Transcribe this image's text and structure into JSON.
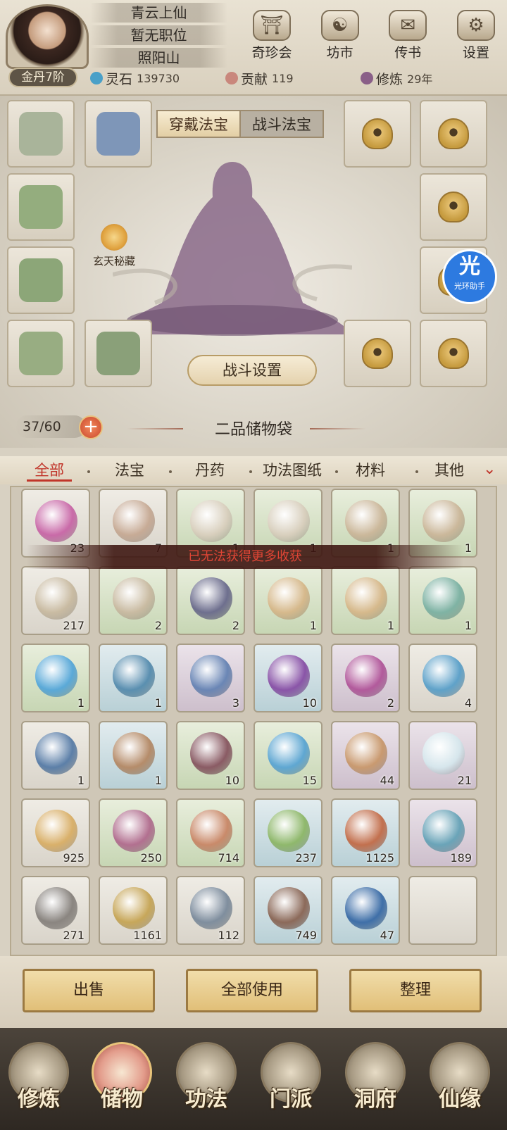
{
  "header": {
    "titles": [
      "青云上仙",
      "暂无职位",
      "照阳山"
    ],
    "realm": "金丹7阶",
    "icons": [
      {
        "label": "奇珍会",
        "icon": "treasure-pavilion-icon"
      },
      {
        "label": "坊市",
        "icon": "market-icon"
      },
      {
        "label": "传书",
        "icon": "scroll-letter-icon"
      },
      {
        "label": "设置",
        "icon": "gear-icon"
      }
    ],
    "resources": [
      {
        "label": "灵石",
        "value": "139730",
        "color": "#4aa0c8"
      },
      {
        "label": "贡献",
        "value": "119",
        "color": "#c9877c"
      },
      {
        "label": "修炼",
        "value": "29年",
        "color": "#8a5f88"
      }
    ]
  },
  "equip": {
    "tab_wear": "穿戴法宝",
    "tab_battle": "战斗法宝",
    "event_label": "玄天秘藏",
    "battle_setting": "战斗设置",
    "helper_big": "光",
    "helper_small": "光环助手",
    "capacity": "37/60",
    "bag_title": "二品储物袋"
  },
  "categories": [
    "全部",
    "法宝",
    "丹药",
    "功法图纸",
    "材料",
    "其他"
  ],
  "toast": "已无法获得更多收获",
  "items": [
    {
      "q": "23",
      "bg": "w",
      "color": "#c96aa8"
    },
    {
      "q": "7",
      "bg": "w",
      "color": "#c7ab96"
    },
    {
      "q": "1",
      "bg": "g",
      "color": "#d8cfbd"
    },
    {
      "q": "1",
      "bg": "g",
      "color": "#d8cfbd"
    },
    {
      "q": "1",
      "bg": "g",
      "color": "#cbb89b"
    },
    {
      "q": "1",
      "bg": "g",
      "color": "#cbb89b"
    },
    {
      "q": "217",
      "bg": "w",
      "color": "#c9bba2"
    },
    {
      "q": "2",
      "bg": "g",
      "color": "#c9bba2"
    },
    {
      "q": "2",
      "bg": "g",
      "color": "#6e6f8e"
    },
    {
      "q": "1",
      "bg": "g",
      "color": "#d6b98c"
    },
    {
      "q": "1",
      "bg": "g",
      "color": "#d6b98c"
    },
    {
      "q": "1",
      "bg": "g",
      "color": "#7fb3a4"
    },
    {
      "q": "1",
      "bg": "g",
      "color": "#5aa9d8"
    },
    {
      "q": "1",
      "bg": "b",
      "color": "#5a8fb0"
    },
    {
      "q": "3",
      "bg": "p",
      "color": "#6a86b5"
    },
    {
      "q": "10",
      "bg": "b",
      "color": "#8a55a8"
    },
    {
      "q": "2",
      "bg": "p",
      "color": "#b25a9c"
    },
    {
      "q": "4",
      "bg": "w",
      "color": "#5fa2c9"
    },
    {
      "q": "1",
      "bg": "w",
      "color": "#5c7fa8"
    },
    {
      "q": "1",
      "bg": "b",
      "color": "#b58c6a"
    },
    {
      "q": "10",
      "bg": "g",
      "color": "#8a5b64"
    },
    {
      "q": "15",
      "bg": "g",
      "color": "#5fa7d2"
    },
    {
      "q": "44",
      "bg": "p",
      "color": "#c99a70"
    },
    {
      "q": "21",
      "bg": "p",
      "color": "#d6e6ec"
    },
    {
      "q": "925",
      "bg": "w",
      "color": "#d9b06a"
    },
    {
      "q": "250",
      "bg": "g",
      "color": "#b27090"
    },
    {
      "q": "714",
      "bg": "g",
      "color": "#c98a6a"
    },
    {
      "q": "237",
      "bg": "b",
      "color": "#8fb86c"
    },
    {
      "q": "1125",
      "bg": "b",
      "color": "#c2704e"
    },
    {
      "q": "189",
      "bg": "p",
      "color": "#6aa4b8"
    },
    {
      "q": "271",
      "bg": "w",
      "color": "#8a8580"
    },
    {
      "q": "1161",
      "bg": "w",
      "color": "#c7a75a"
    },
    {
      "q": "112",
      "bg": "w",
      "color": "#7f8e9e"
    },
    {
      "q": "749",
      "bg": "b",
      "color": "#8c6a5a"
    },
    {
      "q": "47",
      "bg": "b",
      "color": "#3f6fa8"
    },
    {
      "q": "",
      "bg": "w",
      "color": ""
    }
  ],
  "actions": [
    "出售",
    "全部使用",
    "整理"
  ],
  "nav": [
    {
      "label": "修炼",
      "icon": "cultivation-icon"
    },
    {
      "label": "储物",
      "icon": "storage-bag-icon"
    },
    {
      "label": "功法",
      "icon": "manual-scroll-icon"
    },
    {
      "label": "门派",
      "icon": "sect-gate-icon"
    },
    {
      "label": "洞府",
      "icon": "cave-dwelling-icon"
    },
    {
      "label": "仙缘",
      "icon": "immortal-fate-icon"
    }
  ],
  "active_nav": "储物",
  "active_category": "全部"
}
